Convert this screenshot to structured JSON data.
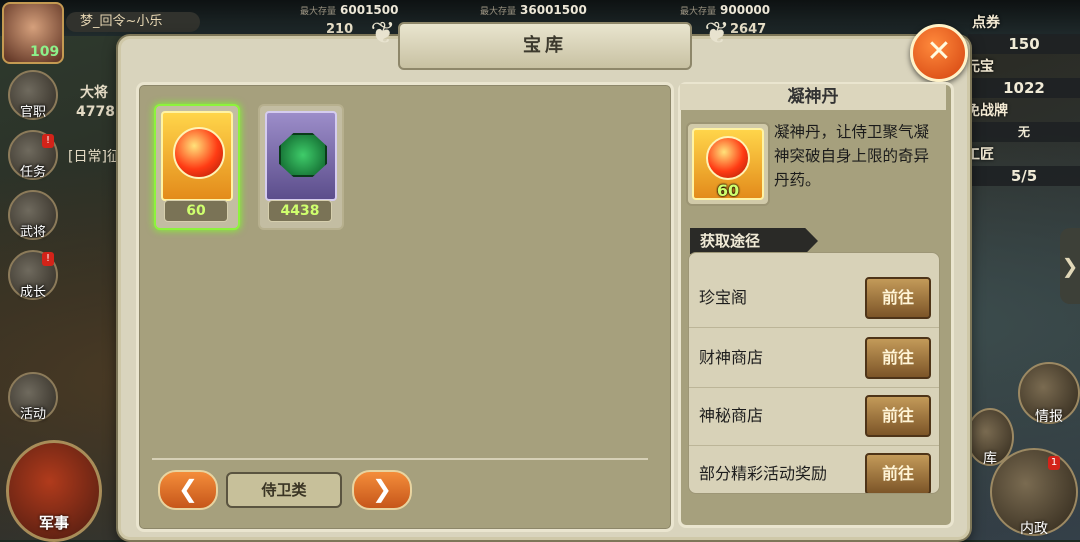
{
  "hud": {
    "level": "109",
    "player_name": "梦_回令~小乐",
    "resources": [
      {
        "cap": "最大存量",
        "val": "36001500",
        "shown": "6001500"
      },
      {
        "cap": "最大存量",
        "val": "36001500"
      },
      {
        "cap": "最大存量",
        "val": "900000"
      }
    ],
    "small_counts": [
      "210",
      "2647"
    ],
    "left_buttons": [
      "官职",
      "任务",
      "武将",
      "成长",
      "活动"
    ],
    "left_badge": "!",
    "general_label": "大将",
    "general_value": "4778",
    "daily_text": "[日常]征",
    "military_button": "军事",
    "right_labels": [
      "点券",
      "元宝",
      "免战牌",
      "工匠"
    ],
    "right_values": [
      "150",
      "1022",
      "无",
      "5/5"
    ],
    "right_buttons": [
      "情报",
      "库",
      "内政"
    ],
    "right_badge": "1",
    "side_arrow": "❯"
  },
  "window": {
    "title": "宝库",
    "close_label": "✕"
  },
  "inventory": {
    "items": [
      {
        "count": "60",
        "selected": true
      },
      {
        "count": "4438",
        "selected": false
      }
    ],
    "prev_label": "❮",
    "next_label": "❯",
    "category_label": "侍卫类"
  },
  "detail": {
    "name": "凝神丹",
    "count": "60",
    "description": "凝神丹，让侍卫聚气凝神突破自身上限的奇异丹药。",
    "source_header": "获取途径",
    "sources": [
      {
        "name": "珍宝阁",
        "button": "前往"
      },
      {
        "name": "财神商店",
        "button": "前往"
      },
      {
        "name": "神秘商店",
        "button": "前往"
      },
      {
        "name": "部分精彩活动奖励",
        "button": "前往"
      }
    ]
  },
  "colors": {
    "panel_bg": "#d9d4bd",
    "grid_bg": "#a6a07d",
    "count_text": "#cfff6e",
    "close_orange": "#f06a20"
  }
}
